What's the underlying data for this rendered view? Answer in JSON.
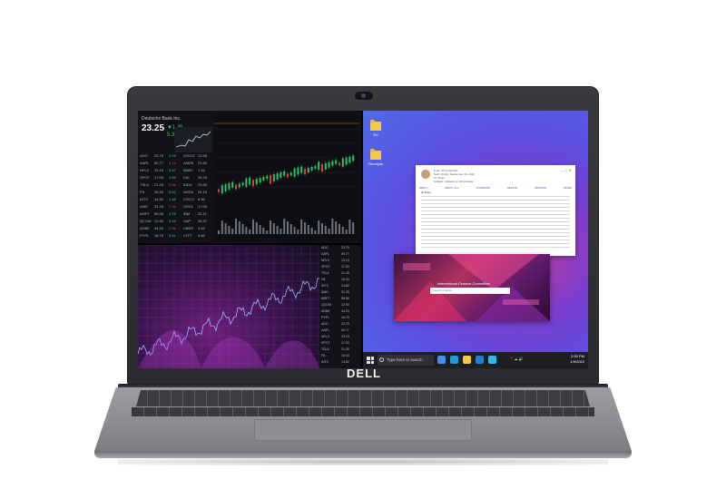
{
  "brand": {
    "logo": "DELL"
  },
  "dashboard": {
    "ticker_title": "Deutsche Bank Inc.",
    "price": "23.25",
    "change": "▼1.45",
    "change_pct": "5.36%",
    "rows": [
      [
        "ADO",
        "23.75",
        "1.29",
        "GOOG",
        "12.58"
      ],
      [
        "AAPL",
        "69.77",
        "1.14",
        "AMZN",
        "21.60"
      ],
      [
        "NFLX",
        "13.19",
        "0.87",
        "BABY",
        "7.44"
      ],
      [
        "SPOT",
        "17.00",
        "1.65",
        "DAI",
        "19.25"
      ],
      [
        "TSLA",
        "21.25",
        "2.08",
        "BIDU",
        "10.80"
      ],
      [
        "FB",
        "16.43",
        "0.62",
        "NVDA",
        "24.15"
      ],
      [
        "INTC",
        "14.82",
        "1.48",
        "CSCO",
        "8.96"
      ],
      [
        "AMD",
        "31.25",
        "2.34",
        "ORCL",
        "17.05"
      ],
      [
        "MSFT",
        "58.06",
        "1.78",
        "IBM",
        "22.11"
      ],
      [
        "QCOM",
        "12.90",
        "0.45",
        "SAP",
        "15.37"
      ],
      [
        "ADBE",
        "44.20",
        "1.96",
        "UBER",
        "9.63"
      ],
      [
        "PYPL",
        "18.75",
        "0.81",
        "LYFT",
        "6.82"
      ]
    ]
  },
  "desktop": {
    "icons": [
      {
        "label": "Ed"
      },
      {
        "label": "Receipts"
      }
    ],
    "mail": {
      "from": "From: Priya Sample",
      "date": "Sent: Friday, September 16, 2022",
      "to": "To: Team",
      "subject": "Subject: Updates on Q4 forecast",
      "actions": [
        "REPLY",
        "REPLY ALL",
        "FORWARD",
        "DELETE",
        "ARCHIVE",
        "MORE"
      ],
      "greeting": "Hi Team,"
    },
    "image_window": {
      "title": "International Finance Committee",
      "search_placeholder": "Search Finance"
    },
    "taskbar": {
      "search_placeholder": "Type here to search",
      "time": "2:30 PM",
      "date": "1/9/2022"
    }
  }
}
